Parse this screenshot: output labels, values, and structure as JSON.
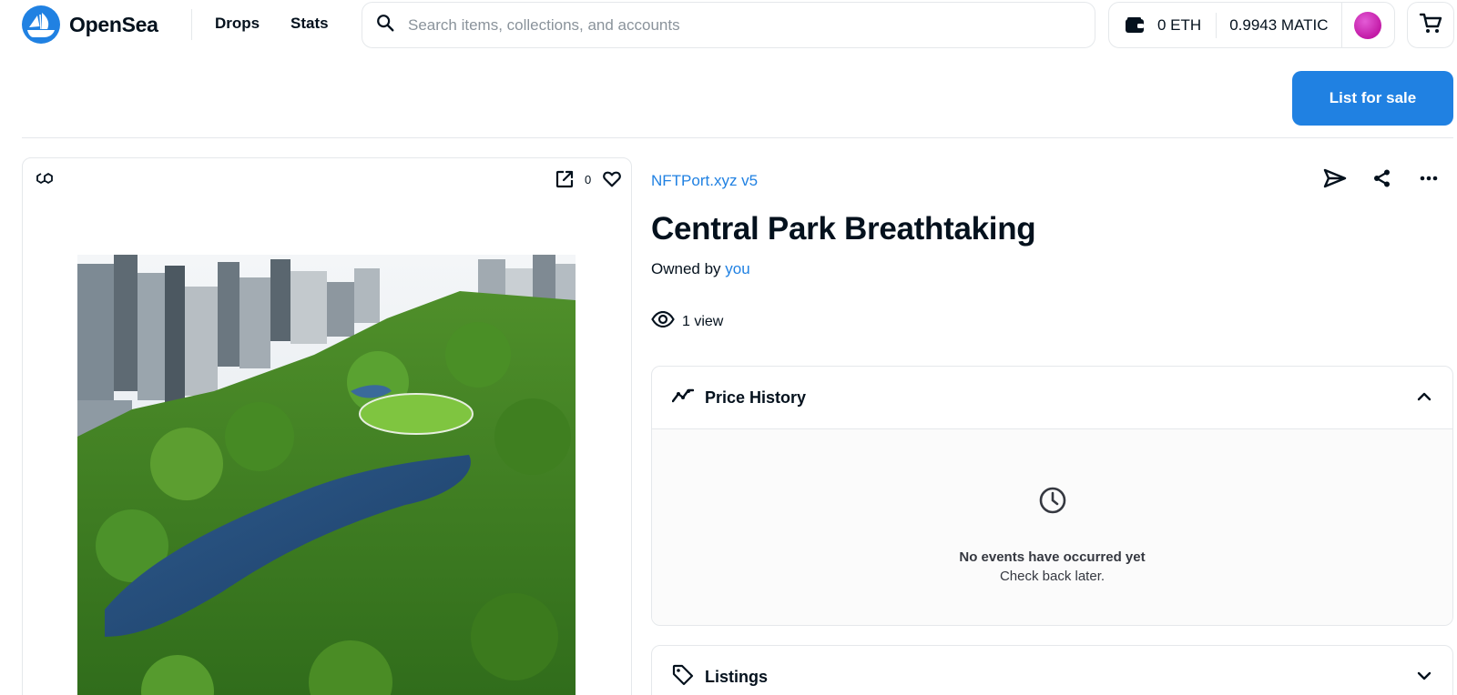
{
  "header": {
    "logo_text": "OpenSea",
    "nav": {
      "drops": "Drops",
      "stats": "Stats"
    },
    "search": {
      "placeholder": "Search items, collections, and accounts",
      "value": ""
    },
    "wallet": {
      "eth": "0 ETH",
      "matic": "0.9943 MATIC"
    }
  },
  "actions": {
    "list_for_sale": "List for sale"
  },
  "media": {
    "favorites_count": "0"
  },
  "item": {
    "collection": "NFTPort.xyz v5",
    "title": "Central Park Breathtaking",
    "owned_by_label": "Owned by",
    "owner": "you",
    "views": "1 view"
  },
  "price_history": {
    "title": "Price History",
    "empty_title": "No events have occurred yet",
    "empty_sub": "Check back later."
  },
  "listings": {
    "title": "Listings"
  },
  "colors": {
    "accent": "#2081e2",
    "text": "#04111d",
    "border": "#e5e8eb"
  },
  "icons": [
    "opensea-logo-icon",
    "search-icon",
    "wallet-icon",
    "avatar",
    "cart-icon",
    "polygon-chain-icon",
    "external-link-icon",
    "heart-icon",
    "send-icon",
    "share-icon",
    "more-icon",
    "eye-icon",
    "trend-icon",
    "chevron-up-icon",
    "clock-icon",
    "tag-icon",
    "chevron-down-icon"
  ]
}
